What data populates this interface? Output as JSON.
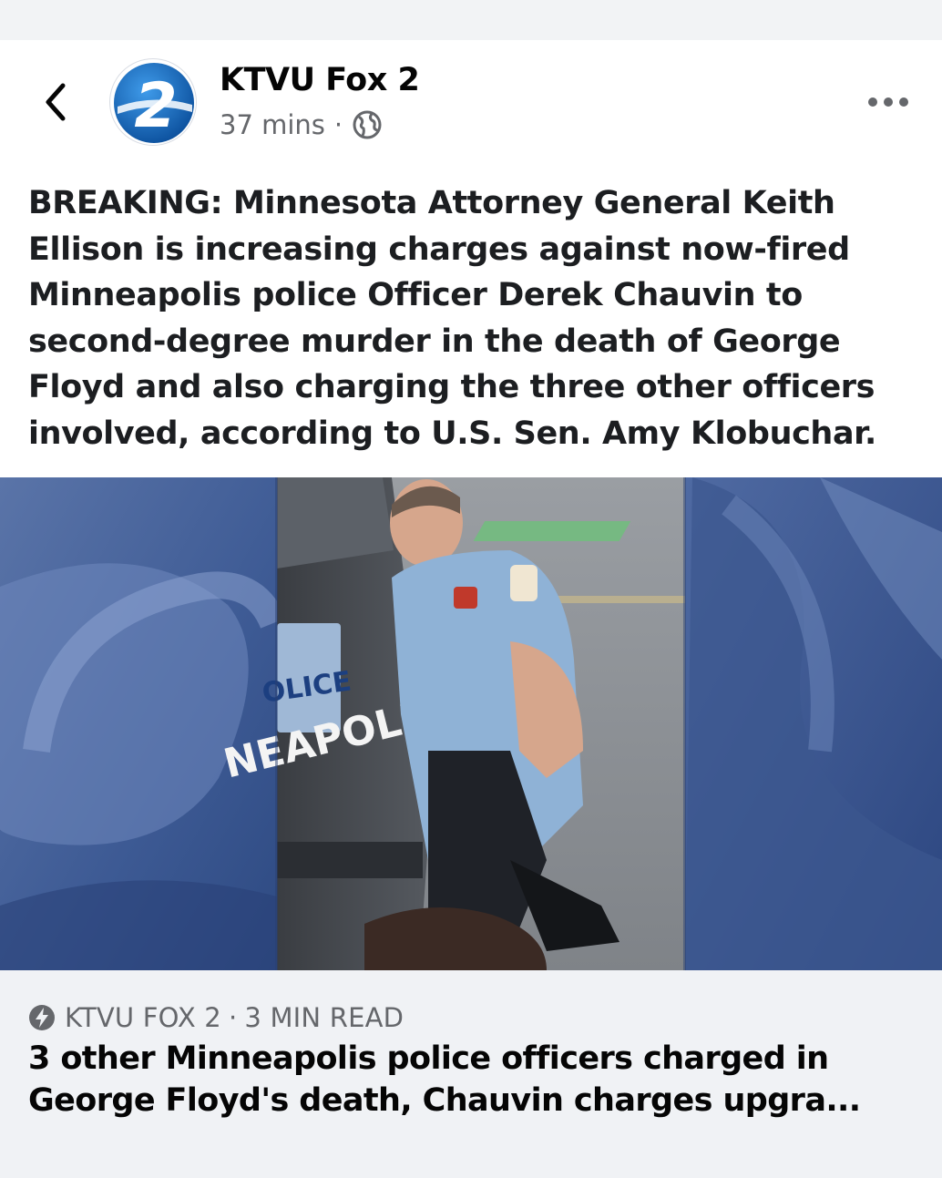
{
  "post": {
    "page_name": "KTVU Fox 2",
    "timestamp": "37 mins",
    "separator": "·",
    "audience_icon": "globe-icon",
    "text": "BREAKING: Minnesota Attorney General Keith Ellison is increasing charges against now-fired Minneapolis police Officer Derek Chauvin to second-degree murder in the death of George Floyd and also charging the three other officers involved, according to U.S. Sen. Amy Klobuchar."
  },
  "header": {
    "back_icon": "chevron-left-icon",
    "more_icon": "more-horizontal-icon",
    "avatar_logo_text": "2"
  },
  "image": {
    "plate_text": "OLICE",
    "vehicle_text": "NEAPOLIS"
  },
  "link_card": {
    "source_icon": "lightning-bolt-icon",
    "source": "KTVU FOX 2",
    "separator": "·",
    "read_time": "3 MIN READ",
    "title": "3 other Minneapolis police officers charged in George Floyd's death, Chauvin charges upgra..."
  },
  "colors": {
    "background": "#f2f3f5",
    "card": "#ffffff",
    "footer": "#f0f2f5",
    "secondary_text": "#65676b",
    "brand_blue": "#1a6fc4"
  }
}
